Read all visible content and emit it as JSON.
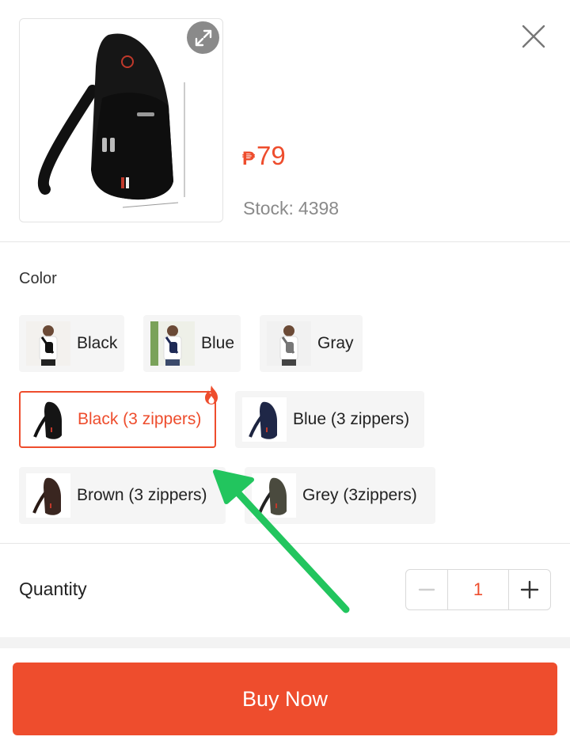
{
  "product": {
    "currency_symbol": "₱",
    "price": "79",
    "stock_label": "Stock:",
    "stock_value": "4398"
  },
  "variation": {
    "section_label": "Color",
    "options": [
      {
        "label": "Black",
        "selected": false
      },
      {
        "label": "Blue",
        "selected": false
      },
      {
        "label": "Gray",
        "selected": false
      },
      {
        "label": "Black (3 zippers)",
        "selected": true,
        "badge": "flame-icon"
      },
      {
        "label": "Blue (3 zippers)",
        "selected": false
      },
      {
        "label": "Brown (3 zippers)",
        "selected": false
      },
      {
        "label": "Grey (3zippers)",
        "selected": false
      }
    ]
  },
  "quantity": {
    "label": "Quantity",
    "value": "1"
  },
  "footer": {
    "buy_now_label": "Buy Now"
  },
  "colors": {
    "accent": "#ee4d2d",
    "annotation_arrow": "#22c55e"
  },
  "annotation": {
    "arrow_points_to": "Black (3 zippers)"
  }
}
